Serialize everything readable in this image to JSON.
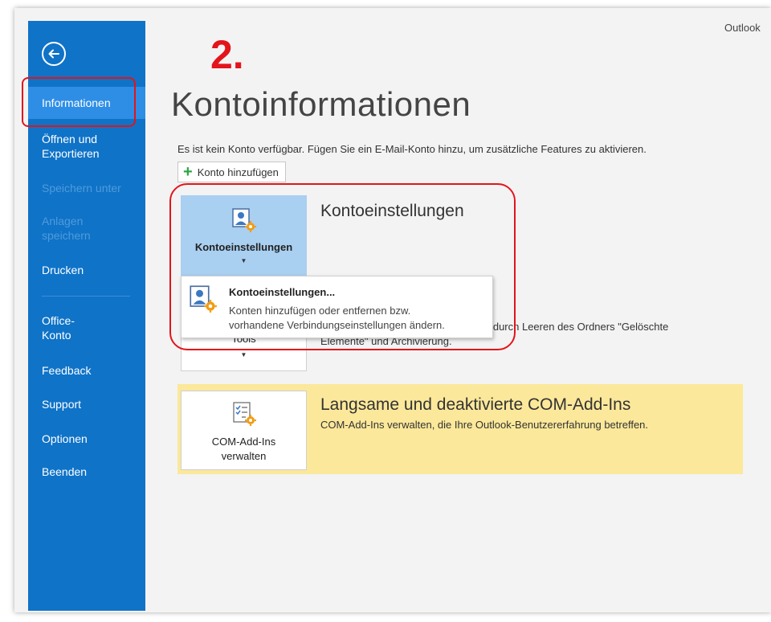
{
  "app": {
    "name": "Outlook"
  },
  "annotation": {
    "step": "2."
  },
  "sidebar": {
    "items": [
      {
        "label": "Informationen",
        "state": "active"
      },
      {
        "label": "Öffnen und Exportieren",
        "line1": "Öffnen und",
        "line2": "Exportieren",
        "state": "enabled"
      },
      {
        "label": "Speichern unter",
        "state": "disabled"
      },
      {
        "label": "Anlagen speichern",
        "line1": "Anlagen",
        "line2": "speichern",
        "state": "disabled"
      },
      {
        "label": "Drucken",
        "state": "enabled"
      },
      {
        "label": "Office-Konto",
        "line1": "Office-",
        "line2": "Konto",
        "state": "enabled"
      },
      {
        "label": "Feedback",
        "state": "enabled"
      },
      {
        "label": "Support",
        "state": "enabled"
      },
      {
        "label": "Optionen",
        "state": "enabled"
      },
      {
        "label": "Beenden",
        "state": "enabled"
      }
    ]
  },
  "main": {
    "title": "Kontoinformationen",
    "info_text": "Es ist kein Konto verfügbar. Fügen Sie ein E-Mail-Konto hinzu, um zusätzliche Features zu aktivieren.",
    "add_account_label": "Konto hinzufügen",
    "account_settings": {
      "tile_label": "Kontoeinstellungen",
      "heading": "Kontoeinstellungen",
      "dropdown": {
        "title": "Kontoeinstellungen...",
        "desc_line1": "Konten hinzufügen oder entfernen bzw.",
        "desc_line2": "vorhandene Verbindungseinstellungen ändern."
      }
    },
    "tools": {
      "tile_label": "Tools",
      "desc_line1": "chs durch Leeren des Ordners \"Gelöschte",
      "desc_line2": "Elemente\" und Archivierung."
    },
    "com_addins": {
      "tile_line1": "COM-Add-Ins",
      "tile_line2": "verwalten",
      "heading": "Langsame und deaktivierte COM-Add-Ins",
      "desc": "COM-Add-Ins verwalten, die Ihre Outlook-Benutzererfahrung betreffen."
    }
  },
  "colors": {
    "sidebar": "#0f73c8",
    "sidebar_active": "#2e8ee6",
    "highlight": "#e3141b",
    "tile_selected": "#a9cff1",
    "yellow_band": "#fbe89a",
    "plus": "#30a446"
  },
  "icons": {
    "back": "arrow-left-circle-icon",
    "add": "plus-icon",
    "account_settings": "account-settings-icon",
    "com_addins": "com-addins-icon"
  }
}
